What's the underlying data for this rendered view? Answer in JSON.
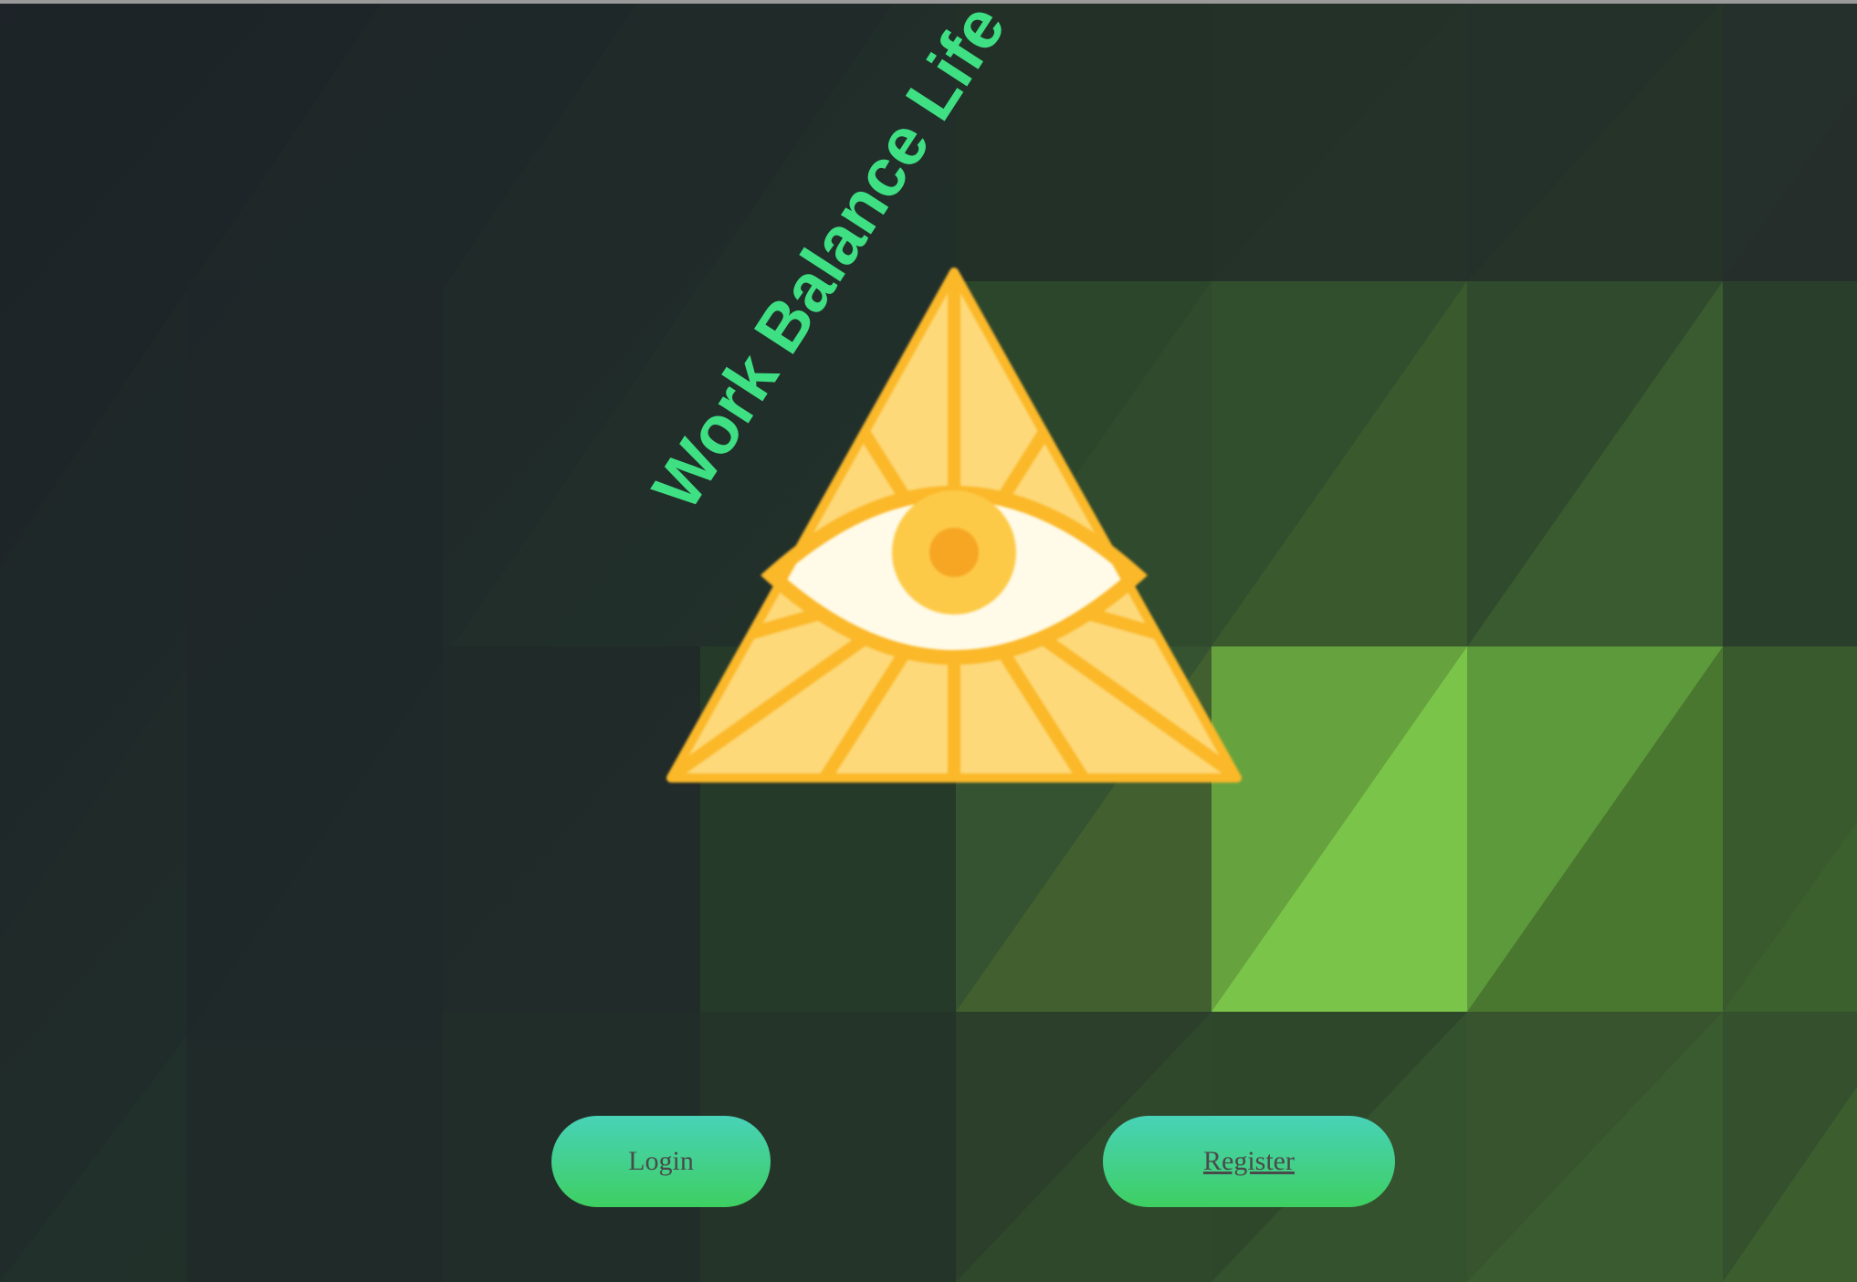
{
  "app": {
    "title": "Work Balance Life"
  },
  "logo": {
    "icon": "all-seeing-eye-pyramid-icon"
  },
  "actions": {
    "login_label": "Login",
    "register_label": "Register"
  },
  "colors": {
    "background": "#1d2227",
    "title": "#3fe083",
    "button_gradient_top": "#48d2b8",
    "button_gradient_bottom": "#3ecf62",
    "button_text": "#4a4a4a",
    "pyramid_fill": "#fdd97a",
    "pyramid_stroke": "#fbb829",
    "tile_highlight": "#7bc44a"
  }
}
